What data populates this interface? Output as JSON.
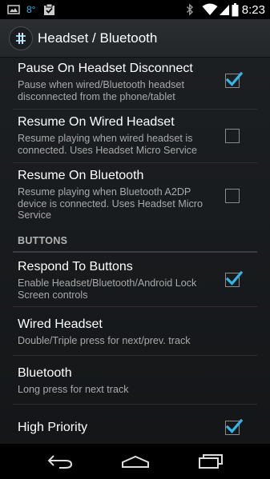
{
  "status_bar": {
    "temperature": "8°",
    "time": "8:23",
    "icons": [
      "gallery-notification-icon",
      "checklist-notification-icon",
      "bluetooth-icon",
      "wifi-icon",
      "signal-icon",
      "battery-icon"
    ]
  },
  "action_bar": {
    "title": "Headset / Bluetooth",
    "logo_icon": "equalizer-app-icon"
  },
  "prefs": {
    "pause_disconnect": {
      "title": "Pause On Headset Disconnect",
      "summary": "Pause when wired/Bluetooth headset disconnected from the phone/tablet",
      "checked": true
    },
    "resume_wired": {
      "title": "Resume On Wired Headset",
      "summary": "Resume playing when wired headset is connected. Uses Headset Micro Service",
      "checked": false
    },
    "resume_bt": {
      "title": "Resume On Bluetooth",
      "summary": "Resume playing when Bluetooth A2DP device is connected. Uses Headset Micro Service",
      "checked": false
    },
    "category_buttons": "BUTTONS",
    "respond_buttons": {
      "title": "Respond To Buttons",
      "summary": "Enable Headset/Bluetooth/Android Lock Screen controls",
      "checked": true
    },
    "wired_headset": {
      "title": "Wired Headset",
      "summary": "Double/Triple press for next/prev. track"
    },
    "bluetooth": {
      "title": "Bluetooth",
      "summary": "Long press for next track"
    },
    "high_priority": {
      "title": "High Priority",
      "checked": true
    }
  },
  "colors": {
    "accent": "#33b5e5",
    "summary_text": "#a9a9a9"
  },
  "nav_bar": {
    "icons": [
      "back-icon",
      "home-icon",
      "recent-apps-icon"
    ]
  }
}
